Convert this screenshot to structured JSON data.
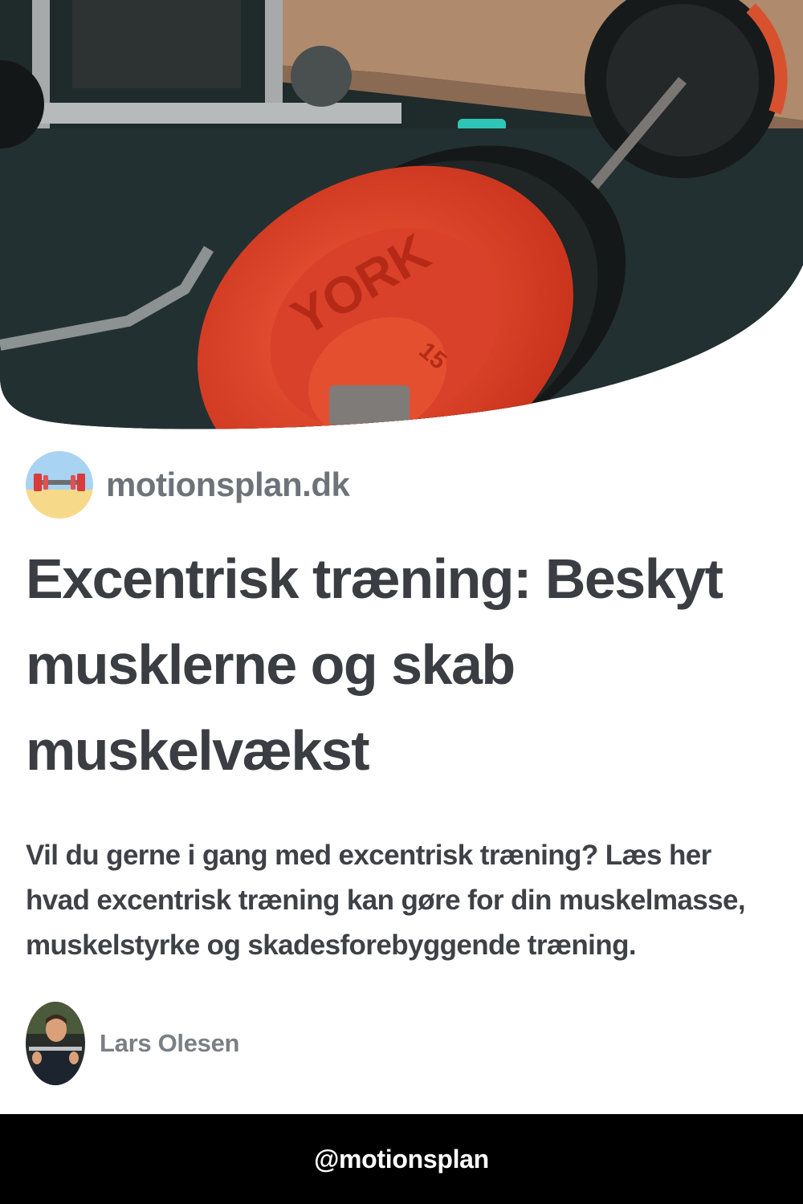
{
  "hero": {
    "plate_brand": "YORK",
    "plate_weight": "15",
    "alt": "Vægtstang med røde vægtskiver i fitnesscenter"
  },
  "brand": {
    "name": "motionsplan.dk",
    "logo_icon": "dumbbell-logo-icon"
  },
  "article": {
    "title": "Excentrisk træning: Beskyt musklerne og skab muskelvækst",
    "description": "Vil du gerne i gang med excentrisk træning? Læs her hvad excentrisk træning kan gøre for din muskelmasse, muskelstyrke og skadesforebyggende træning."
  },
  "author": {
    "name": "Lars Olesen"
  },
  "footer": {
    "handle": "@motionsplan"
  },
  "colors": {
    "background": "#ffffff",
    "title": "#3a3d42",
    "muted": "#6e737a",
    "footer_bg": "#000000",
    "plate_red": "#e8452c"
  }
}
